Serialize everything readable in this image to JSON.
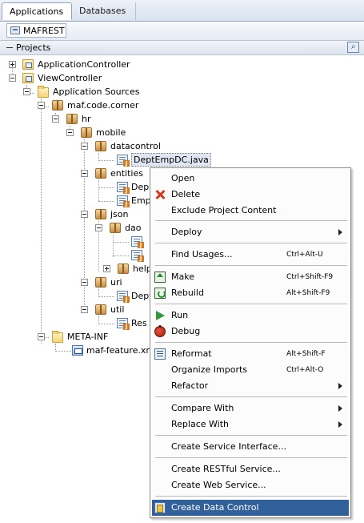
{
  "tabs": [
    {
      "label": "Applications",
      "active": true
    },
    {
      "label": "Databases",
      "active": false
    }
  ],
  "project_selector": {
    "value": "MAFREST"
  },
  "projects_panel": {
    "title": "Projects",
    "search_icon": "search-icon"
  },
  "tree": {
    "application_controller": "ApplicationController",
    "view_controller": "ViewController",
    "application_sources": "Application Sources",
    "pkg_maf": "maf.code.corner",
    "pkg_hr": "hr",
    "pkg_mobile": "mobile",
    "pkg_datacontrol": "datacontrol",
    "file_deptempdc": "DeptEmpDC.java",
    "pkg_entities": "entities",
    "entities_file1": "Dep",
    "entities_file2": "Emp",
    "pkg_json": "json",
    "pkg_dao": "dao",
    "pkg_help": "help",
    "pkg_uri": "uri",
    "uri_file": "Dept",
    "pkg_util": "util",
    "util_file": "Res",
    "meta_inf": "META-INF",
    "maf_feature": "maf-feature.xml"
  },
  "context_menu": {
    "open": "Open",
    "delete": "Delete",
    "exclude": "Exclude Project Content",
    "deploy": "Deploy",
    "find_usages": "Find Usages...",
    "find_usages_key": "Ctrl+Alt-U",
    "make": "Make",
    "make_key": "Ctrl+Shift-F9",
    "rebuild": "Rebuild",
    "rebuild_key": "Alt+Shift-F9",
    "run": "Run",
    "debug": "Debug",
    "reformat": "Reformat",
    "reformat_key": "Alt+Shift-F",
    "organize_imports": "Organize Imports",
    "organize_imports_key": "Ctrl+Alt-O",
    "refactor": "Refactor",
    "compare_with": "Compare With",
    "replace_with": "Replace With",
    "create_service_interface": "Create Service Interface...",
    "create_restful_service": "Create RESTful Service...",
    "create_web_service": "Create Web Service...",
    "create_data_control": "Create Data Control"
  },
  "colors": {
    "menu_highlight": "#31609b",
    "tab_border": "#8ea3bf"
  }
}
